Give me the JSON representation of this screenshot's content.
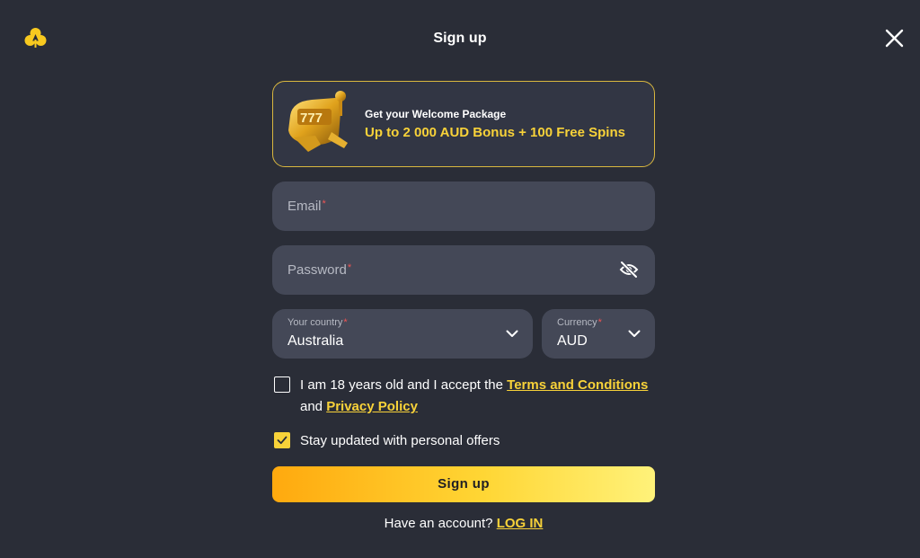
{
  "header": {
    "title": "Sign up",
    "logo_icon": "clover-logo-icon",
    "close_icon": "close-icon"
  },
  "promo": {
    "subtitle": "Get your Welcome Package",
    "headline": "Up to 2 000 AUD Bonus + 100 Free Spins",
    "image_icon": "slot-machine-777-icon"
  },
  "form": {
    "email_placeholder": "Email",
    "password_placeholder": "Password",
    "required_mark": "*",
    "country_label": "Your country",
    "country_value": "Australia",
    "currency_label": "Currency",
    "currency_value": "AUD",
    "terms_prefix": "I am 18 years old and I accept the",
    "terms_link": "Terms and Conditions",
    "terms_and": "and",
    "privacy_link": "Privacy Policy",
    "offers_label": "Stay updated with personal offers",
    "terms_checked": false,
    "offers_checked": true,
    "submit_label": "Sign up",
    "have_account": "Have an account?",
    "login_link": "LOG IN"
  },
  "colors": {
    "background": "#2a2d37",
    "field": "#444857",
    "accent": "#f8d239",
    "required": "#f05454"
  }
}
